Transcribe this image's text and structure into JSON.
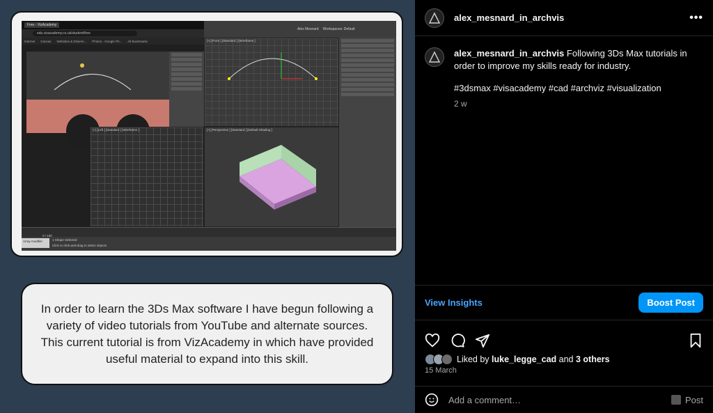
{
  "post": {
    "username": "alex_mesnard_in_archvis",
    "caption": "Following 3Ds Max tutorials in order to improve my skills ready for industry.",
    "hashtags": "#3dsmax #visacademy #cad #archviz #visualization",
    "time_ago": "2 w",
    "image_caption": "In order to learn the 3Ds Max software I have begun following a variety of video tutorials from YouTube and alternate sources. This current tutorial is from VizAcademy in which have provided useful material to expand into this skill.",
    "more_label": "•••"
  },
  "screenshot": {
    "browser_tab": "Free - VizAcademy",
    "url": "edu.vizacademy.co.uk/student/free",
    "bookmarks": [
      "Internet",
      "Canvas",
      "Websites & Dissem...",
      "Photos - Google Ph...",
      "All Bookmarks"
    ],
    "viewport_front": "[+] [Front ] [Standard ] [Wireframe ]",
    "viewport_left": "[+] [Left ] [Standard ] [Wireframe ]",
    "viewport_persp": "[+] [Perspective ] [Standard ] [Default Shading ]",
    "status_left": "Array modifier",
    "status_selected": "1 Shape Selected",
    "status_hint": "Click or click-and-drag to select objects",
    "frame_counter": "0 / 100",
    "user_label": "Alex Mesnard",
    "workspace": "Workspaces: Default",
    "right_panel_items": [
      "Line001",
      "Modifier List",
      "Line",
      "Rendering",
      "Selection",
      "Soft Selection",
      "Geometry"
    ]
  },
  "actions": {
    "view_insights": "View Insights",
    "boost_post": "Boost Post"
  },
  "likes": {
    "prefix": "Liked by",
    "user": "luke_legge_cad",
    "and": "and",
    "others": "3 others",
    "date": "15 March"
  },
  "comment": {
    "placeholder": "Add a comment…",
    "post_label": "Post"
  },
  "colors": {
    "accent": "#0095f6",
    "link": "#4aa3ff",
    "image_bg": "#2c3e50"
  }
}
